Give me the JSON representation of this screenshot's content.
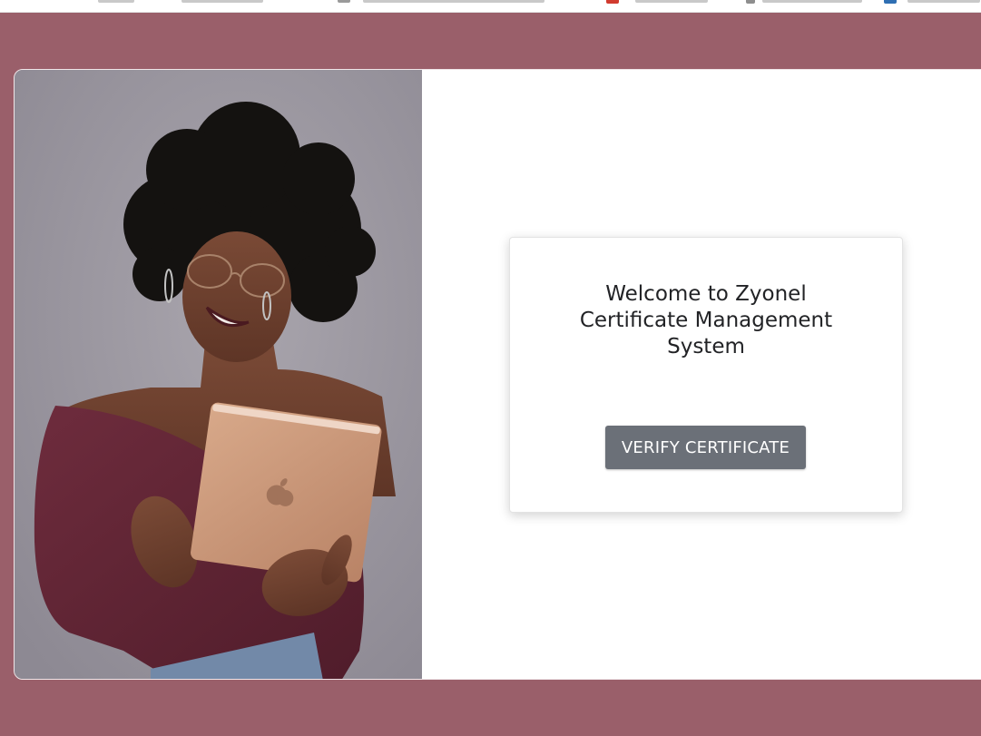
{
  "colors": {
    "page_background": "#9a5f6a",
    "card_background": "#ffffff",
    "button_background": "#6b7078",
    "button_text": "#ffffff",
    "title_text": "#222326"
  },
  "hero": {
    "image_subject": "woman-with-tablet-photo"
  },
  "welcome": {
    "title": "Welcome to Zyonel Certificate Management System",
    "verify_button_label": "VERIFY CERTIFICATE"
  },
  "icons": {
    "tablet_logo": "apple-logo-icon"
  }
}
